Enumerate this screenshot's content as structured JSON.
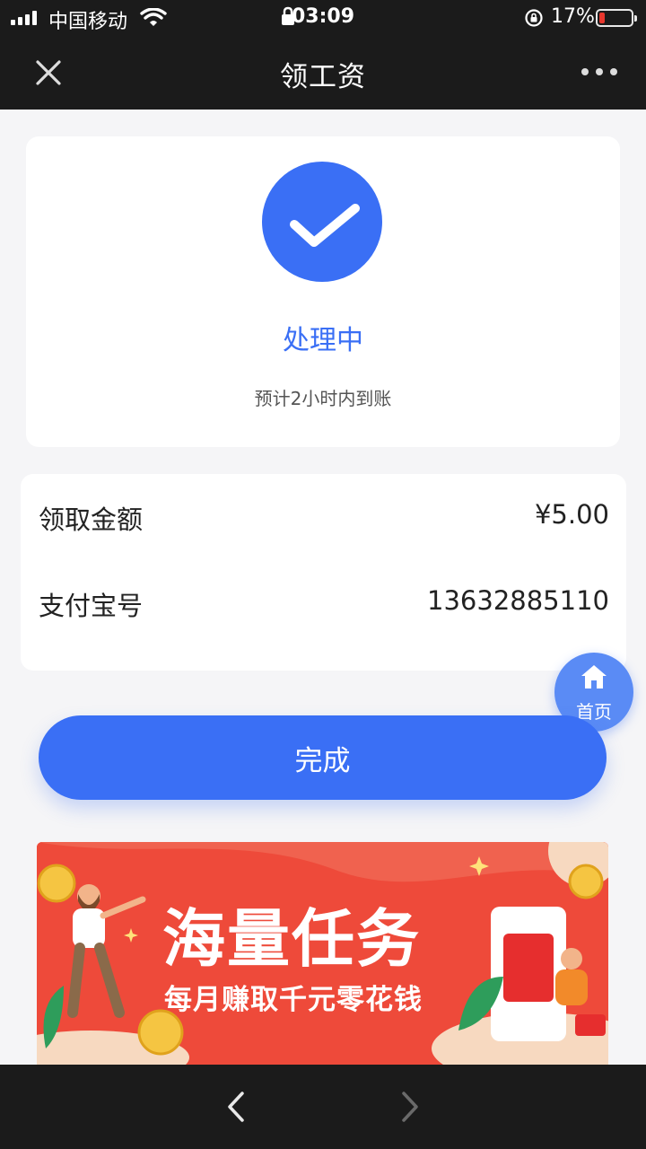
{
  "status_bar": {
    "carrier": "中国移动",
    "time": "03:09",
    "battery_pct": "17%",
    "battery_level": 0.17,
    "battery_color": "#ff3b30"
  },
  "nav": {
    "title": "领工资",
    "close_icon": "close-icon",
    "more_icon": "more-dots-icon"
  },
  "status": {
    "title": "处理中",
    "subtitle": "预计2小时内到账",
    "icon": "check-icon"
  },
  "info": {
    "rows": [
      {
        "label": "领取金额",
        "value": "¥5.00"
      },
      {
        "label": "支付宝号",
        "value": "13632885110"
      }
    ]
  },
  "home_button": {
    "label": "首页",
    "icon": "home-icon"
  },
  "done_button": {
    "label": "完成"
  },
  "banner": {
    "title": "海量任务",
    "subtitle": "每月赚取千元零花钱"
  },
  "toolbar": {
    "back_icon": "chevron-left-icon",
    "forward_icon": "chevron-right-icon"
  },
  "colors": {
    "accent": "#3a6ff5",
    "bar_bg": "#1b1b1b",
    "page_bg": "#f5f5f7",
    "banner_bg": "#ee4a3a"
  }
}
